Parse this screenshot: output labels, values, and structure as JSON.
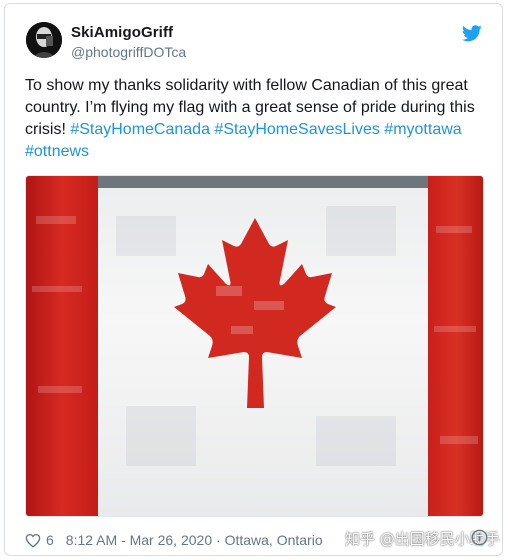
{
  "tweet": {
    "display_name": "SkiAmigoGriff",
    "handle": "@photogriffDOTca",
    "text_plain": "To show my thanks solidarity with fellow Canadian of this great country. I’m flying my flag with a great sense of pride during this crisis! ",
    "hashtags": [
      "#StayHomeCanada",
      "#StayHomeSavesLives",
      "#myottawa",
      "#ottnews"
    ],
    "media_icon": "canada-flag-photo",
    "like_count": "6",
    "timestamp": "8:12 AM - Mar 26, 2020",
    "separator": " · ",
    "location": "Ottawa, Ontario"
  },
  "watermark": {
    "text": "知乎 @出国移民小助手"
  },
  "colors": {
    "text": "#14171a",
    "secondary": "#657786",
    "hashtag": "#1b95e0",
    "twitter_blue": "#1da1f2",
    "flag_red": "#d52b1e"
  }
}
